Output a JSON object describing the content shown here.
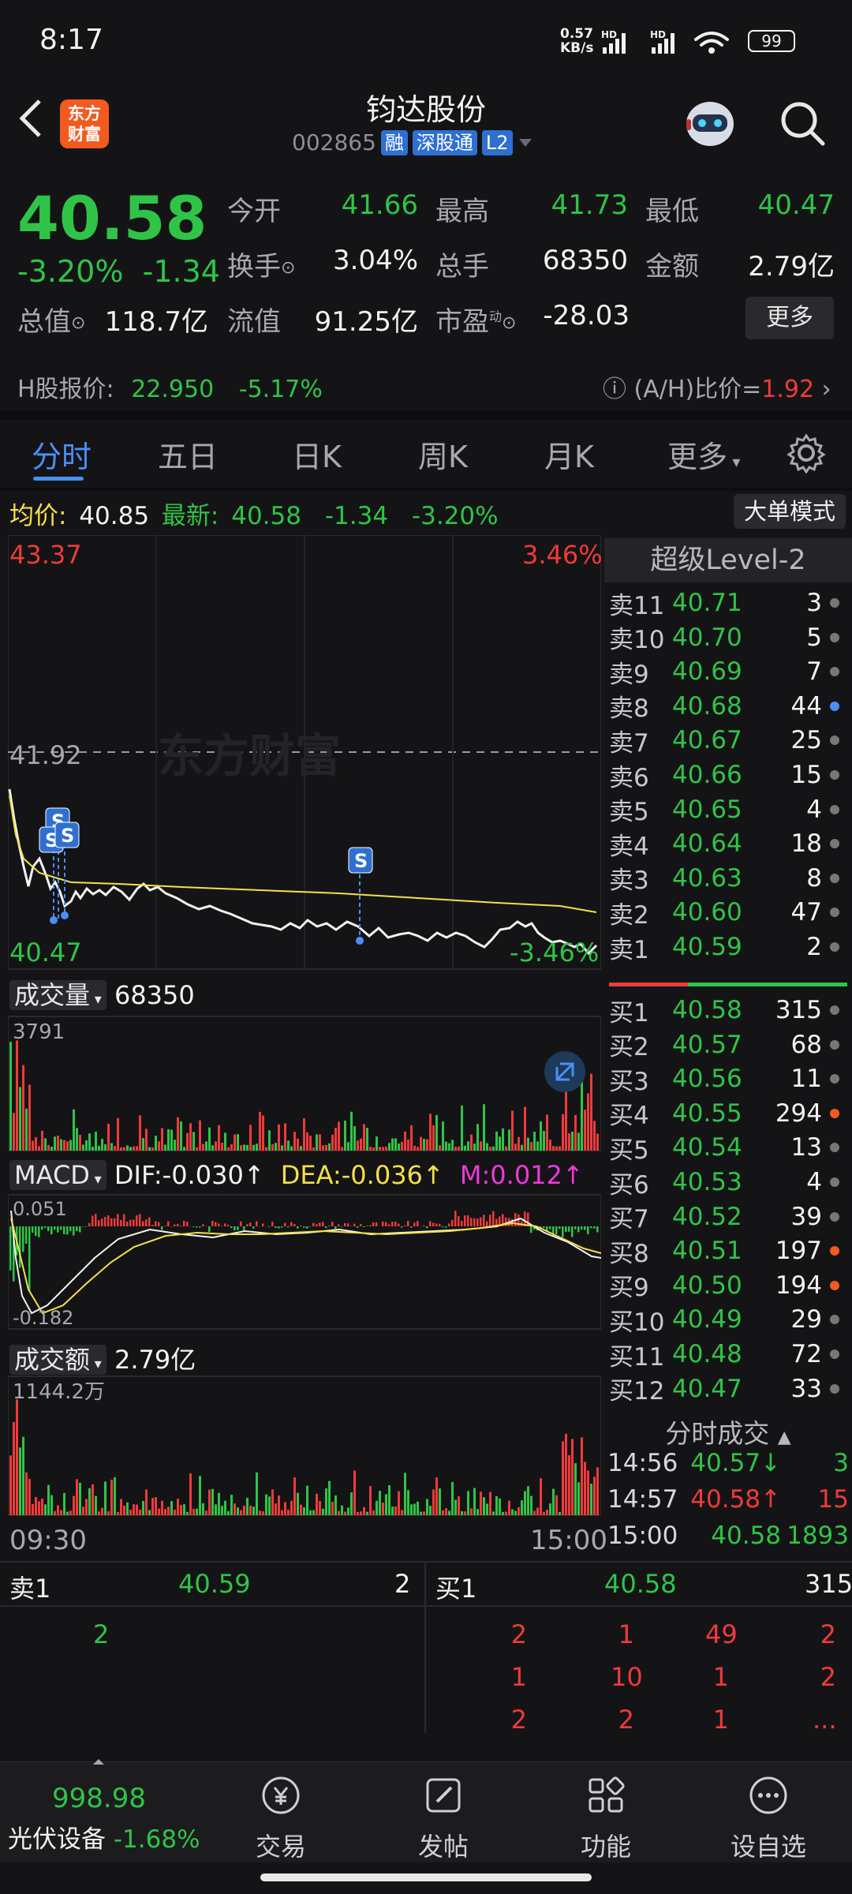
{
  "status": {
    "time": "8:17",
    "speed": "0.57",
    "speed_unit": "KB/s",
    "battery": "99"
  },
  "header": {
    "logo_line1": "东方",
    "logo_line2": "财富",
    "name": "钧达股份",
    "code": "002865",
    "tags": [
      "融",
      "深股通",
      "L2"
    ]
  },
  "quote": {
    "price": "40.58",
    "pct": "-3.20%",
    "change": "-1.34",
    "open_label": "今开",
    "open": "41.66",
    "high_label": "最高",
    "high": "41.73",
    "low_label": "最低",
    "low": "40.47",
    "turnover_label": "换手",
    "turnover": "3.04%",
    "volume_label": "总手",
    "volume": "68350",
    "amount_label": "金额",
    "amount": "2.79亿",
    "mktcap_label": "总值",
    "mktcap": "118.7亿",
    "float_label": "流值",
    "float": "91.25亿",
    "pe_label": "市盈",
    "pe_sup": "动",
    "pe": "-28.03",
    "more": "更多"
  },
  "hshare": {
    "label": "H股报价:",
    "price": "22.950",
    "pct": "-5.17%",
    "ah_label": "(A/H)比价=",
    "ah": "1.92"
  },
  "tabs": [
    "分时",
    "五日",
    "日K",
    "周K",
    "月K",
    "更多"
  ],
  "info": {
    "avg_label": "均价:",
    "avg": "40.85",
    "latest_label": "最新:",
    "latest": "40.58",
    "chg": "-1.34",
    "pct": "-3.20%",
    "mode_btn": "大单模式"
  },
  "chart": {
    "top_left": "43.37",
    "top_right": "3.46%",
    "mid": "41.92",
    "bottom_left": "40.47",
    "bottom_right": "-3.46%",
    "watermark": "东方财富",
    "signal": "S"
  },
  "volume": {
    "label": "成交量",
    "value": "68350",
    "max": "3791"
  },
  "macd": {
    "label": "MACD",
    "dif": "DIF:-0.030",
    "dea": "DEA:-0.036",
    "m": "M:0.012",
    "top": "0.051",
    "bottom": "-0.182"
  },
  "amount": {
    "label": "成交额",
    "value": "2.79亿",
    "max": "1144.2万"
  },
  "times": {
    "start": "09:30",
    "end": "15:00"
  },
  "book": {
    "header": "超级Level-2",
    "asks": [
      {
        "label": "卖11",
        "price": "40.71",
        "qty": "3"
      },
      {
        "label": "卖10",
        "price": "40.70",
        "qty": "5"
      },
      {
        "label": "卖9",
        "price": "40.69",
        "qty": "7"
      },
      {
        "label": "卖8",
        "price": "40.68",
        "qty": "44"
      },
      {
        "label": "卖7",
        "price": "40.67",
        "qty": "25"
      },
      {
        "label": "卖6",
        "price": "40.66",
        "qty": "15"
      },
      {
        "label": "卖5",
        "price": "40.65",
        "qty": "4"
      },
      {
        "label": "卖4",
        "price": "40.64",
        "qty": "18"
      },
      {
        "label": "卖3",
        "price": "40.63",
        "qty": "8"
      },
      {
        "label": "卖2",
        "price": "40.60",
        "qty": "47"
      },
      {
        "label": "卖1",
        "price": "40.59",
        "qty": "2"
      }
    ],
    "bids": [
      {
        "label": "买1",
        "price": "40.58",
        "qty": "315"
      },
      {
        "label": "买2",
        "price": "40.57",
        "qty": "68"
      },
      {
        "label": "买3",
        "price": "40.56",
        "qty": "11"
      },
      {
        "label": "买4",
        "price": "40.55",
        "qty": "294"
      },
      {
        "label": "买5",
        "price": "40.54",
        "qty": "13"
      },
      {
        "label": "买6",
        "price": "40.53",
        "qty": "4"
      },
      {
        "label": "买7",
        "price": "40.52",
        "qty": "39"
      },
      {
        "label": "买8",
        "price": "40.51",
        "qty": "197"
      },
      {
        "label": "买9",
        "price": "40.50",
        "qty": "194"
      },
      {
        "label": "买10",
        "price": "40.49",
        "qty": "29"
      },
      {
        "label": "买11",
        "price": "40.48",
        "qty": "72"
      },
      {
        "label": "买12",
        "price": "40.47",
        "qty": "33"
      }
    ]
  },
  "trades": {
    "title": "分时成交",
    "rows": [
      {
        "time": "14:56",
        "price": "40.57↓",
        "vol": "3"
      },
      {
        "time": "14:57",
        "price": "40.58↑",
        "vol": "15"
      },
      {
        "time": "15:00",
        "price": "40.58",
        "vol": "1893"
      }
    ]
  },
  "queue": {
    "sell_label": "卖1",
    "sell_price": "40.59",
    "sell_qty": "2",
    "buy_label": "买1",
    "buy_price": "40.58",
    "buy_qty": "315",
    "sell_items": [
      "2"
    ],
    "buy_rows": [
      [
        "2",
        "1",
        "49",
        "2"
      ],
      [
        "1",
        "10",
        "1",
        "2"
      ],
      [
        "2",
        "2",
        "1",
        "..."
      ]
    ]
  },
  "nav": {
    "index_value": "998.98",
    "index_name": "光伏设备",
    "index_pct": "-1.68%",
    "items": [
      "交易",
      "发帖",
      "功能",
      "设自选"
    ]
  }
}
